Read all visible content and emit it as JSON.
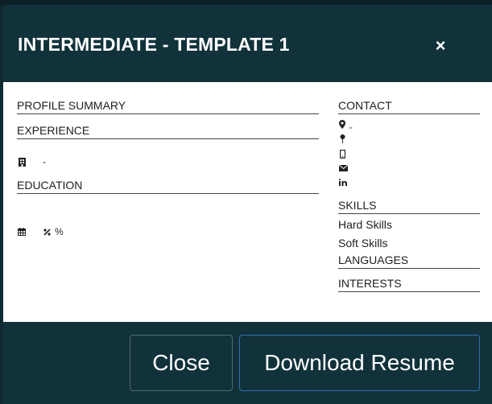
{
  "modal": {
    "title": "INTERMEDIATE - TEMPLATE 1",
    "close_glyph": "×"
  },
  "resume": {
    "left": {
      "profile_summary": "PROFILE SUMMARY",
      "experience": "EXPERIENCE",
      "experience_row_text": "-",
      "education": "EDUCATION",
      "education_row_text": "%"
    },
    "right": {
      "contact": "CONTACT",
      "location_text": ",,",
      "skills": "SKILLS",
      "hard_skills": "Hard Skills",
      "soft_skills": "Soft Skills",
      "languages": "LANGUAGES",
      "interests": "INTERESTS"
    }
  },
  "footer": {
    "close_label": "Close",
    "download_label": "Download Resume"
  },
  "icons": {
    "building": "building-icon",
    "calendar": "calendar-icon",
    "percent": "percent-icon",
    "map_marker": "map-marker-icon",
    "pin": "pin-icon",
    "mobile": "mobile-icon",
    "envelope": "envelope-icon",
    "linkedin": "linkedin-icon"
  },
  "colors": {
    "header_bg": "#12323b",
    "body_bg": "#ffffff",
    "download_border": "#2f6fb0"
  }
}
